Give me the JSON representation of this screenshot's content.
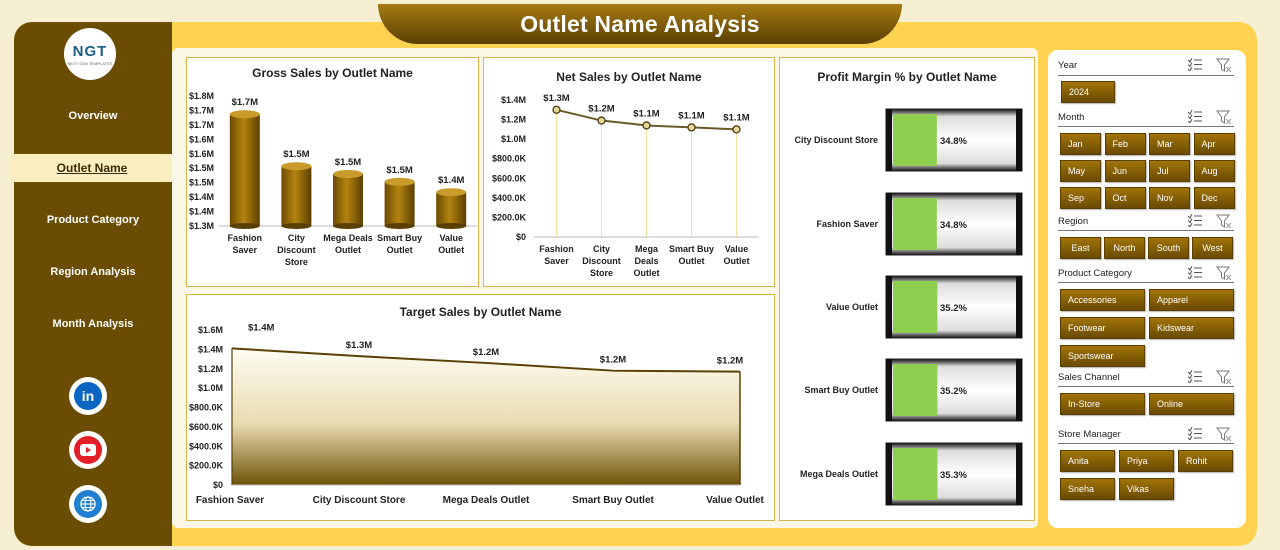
{
  "header": {
    "title": "Outlet Name Analysis"
  },
  "logo": {
    "text": "NGT",
    "subtitle": "NEXT GEN TEMPLATES"
  },
  "nav": {
    "items": [
      {
        "label": "Overview",
        "active": false
      },
      {
        "label": "Outlet Name",
        "active": true
      },
      {
        "label": "Product Category",
        "active": false
      },
      {
        "label": "Region Analysis",
        "active": false
      },
      {
        "label": "Month Analysis",
        "active": false
      }
    ]
  },
  "social": {
    "linkedin": "in"
  },
  "colors": {
    "gold": "#6a4c03",
    "frame": "#ffd352",
    "margin_fill": "#8ecf50",
    "line": "#5a4004"
  },
  "slicers": {
    "year": {
      "label": "Year",
      "options": [
        "2024"
      ]
    },
    "month": {
      "label": "Month",
      "options": [
        "Jan",
        "Feb",
        "Mar",
        "Apr",
        "May",
        "Jun",
        "Jul",
        "Aug",
        "Sep",
        "Oct",
        "Nov",
        "Dec"
      ]
    },
    "region": {
      "label": "Region",
      "options": [
        "East",
        "North",
        "South",
        "West"
      ]
    },
    "product_category": {
      "label": "Product Category",
      "options": [
        "Accessories",
        "Apparel",
        "Footwear",
        "Kidswear",
        "Sportswear"
      ]
    },
    "sales_channel": {
      "label": "Sales Channel",
      "options": [
        "In-Store",
        "Online"
      ]
    },
    "store_manager": {
      "label": "Store Manager",
      "options": [
        "Anita",
        "Priya",
        "Rohit",
        "Sneha",
        "Vikas"
      ]
    }
  },
  "chart_data": [
    {
      "id": "gross",
      "type": "bar",
      "title": "Gross Sales by Outlet Name",
      "categories": [
        "Fashion Saver",
        "City Discount Store",
        "Mega Deals Outlet",
        "Smart Buy Outlet",
        "Value Outlet"
      ],
      "category_lines": [
        [
          "Fashion",
          "Saver"
        ],
        [
          "City",
          "Discount",
          "Store"
        ],
        [
          "Mega Deals",
          "Outlet"
        ],
        [
          "Smart Buy",
          "Outlet"
        ],
        [
          "Value",
          "Outlet"
        ]
      ],
      "values": [
        1.73,
        1.53,
        1.5,
        1.47,
        1.43
      ],
      "data_labels": [
        "$1.7M",
        "$1.5M",
        "$1.5M",
        "$1.5M",
        "$1.4M"
      ],
      "yticks": [
        "$1.3M",
        "$1.4M",
        "$1.4M",
        "$1.5M",
        "$1.5M",
        "$1.6M",
        "$1.6M",
        "$1.7M",
        "$1.7M",
        "$1.8M"
      ],
      "ylim": [
        1.3,
        1.8
      ]
    },
    {
      "id": "net",
      "type": "line",
      "title": "Net Sales by Outlet Name",
      "categories": [
        "Fashion Saver",
        "City Discount Store",
        "Mega Deals Outlet",
        "Smart Buy Outlet",
        "Value Outlet"
      ],
      "category_lines": [
        [
          "Fashion",
          "Saver"
        ],
        [
          "City",
          "Discount",
          "Store"
        ],
        [
          "Mega",
          "Deals",
          "Outlet"
        ],
        [
          "Smart Buy",
          "Outlet"
        ],
        [
          "Value",
          "Outlet"
        ]
      ],
      "values": [
        1.3,
        1.19,
        1.14,
        1.12,
        1.1
      ],
      "data_labels": [
        "$1.3M",
        "$1.2M",
        "$1.1M",
        "$1.1M",
        "$1.1M"
      ],
      "yticks": [
        "$0",
        "$200.0K",
        "$400.0K",
        "$600.0K",
        "$800.0K",
        "$1.0M",
        "$1.2M",
        "$1.4M"
      ],
      "ylim": [
        0,
        1.4
      ]
    },
    {
      "id": "target",
      "type": "area",
      "title": "Target Sales by Outlet Name",
      "categories": [
        "Fashion Saver",
        "City Discount Store",
        "Mega Deals Outlet",
        "Smart Buy Outlet",
        "Value Outlet"
      ],
      "values": [
        1.41,
        1.33,
        1.26,
        1.18,
        1.17
      ],
      "data_labels": [
        "$1.4M",
        "$1.3M",
        "$1.2M",
        "$1.2M",
        "$1.2M"
      ],
      "yticks": [
        "$0",
        "$200.0K",
        "$400.0K",
        "$600.0K",
        "$800.0K",
        "$1.0M",
        "$1.2M",
        "$1.4M",
        "$1.6M"
      ],
      "ylim": [
        0,
        1.6
      ]
    },
    {
      "id": "margin",
      "type": "bar",
      "title": "Profit Margin % by Outlet Name",
      "categories": [
        "City Discount Store",
        "Fashion Saver",
        "Value Outlet",
        "Smart Buy Outlet",
        "Mega Deals Outlet"
      ],
      "values": [
        34.8,
        34.8,
        35.2,
        35.2,
        35.3
      ],
      "data_labels": [
        "34.8%",
        "34.8%",
        "35.2%",
        "35.2%",
        "35.3%"
      ]
    }
  ]
}
